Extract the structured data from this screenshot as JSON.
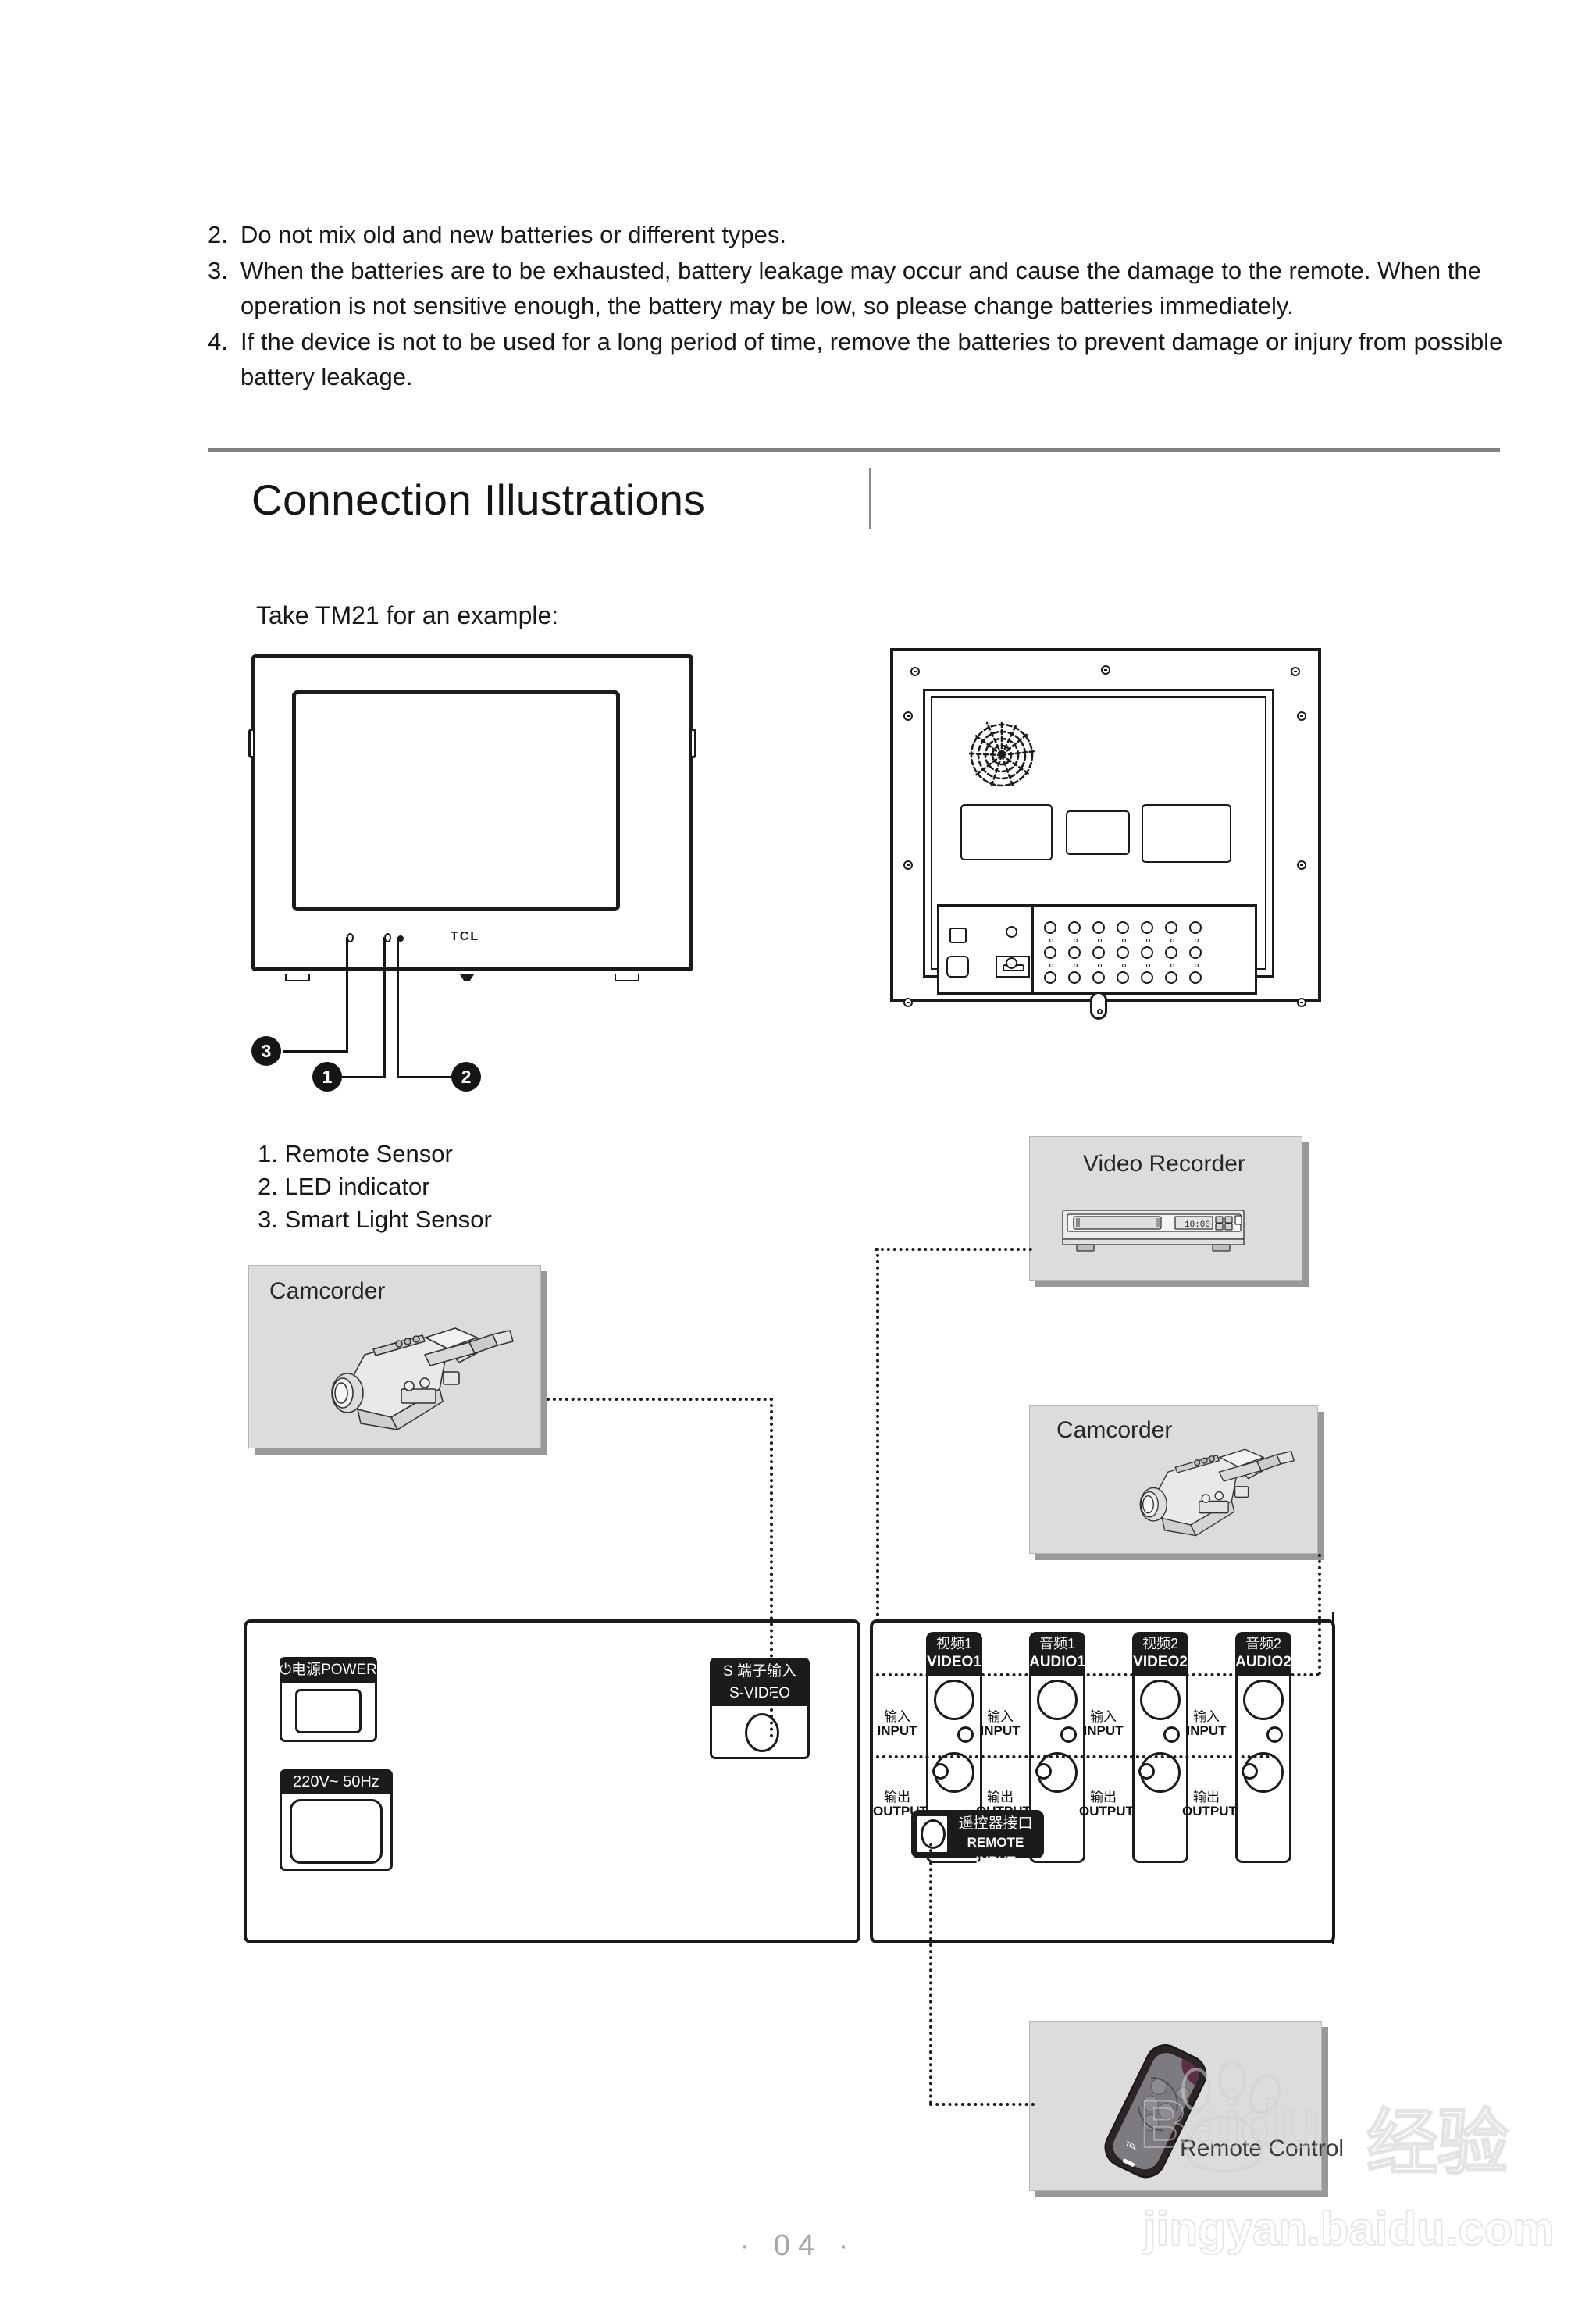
{
  "notes": [
    {
      "num": "2.",
      "text": "Do not mix old and new batteries or different types."
    },
    {
      "num": "3.",
      "text": "When the batteries are to be exhausted, battery leakage may occur and cause the damage to the remote. When the operation is not sensitive enough, the battery may be low, so please change batteries immediately."
    },
    {
      "num": "4.",
      "text": "If the device is not to be used for a long period of time, remove the batteries to prevent damage or injury from possible battery leakage."
    }
  ],
  "section": {
    "title": "Connection Illustrations",
    "example_line": "Take TM21 for an example:"
  },
  "front_view": {
    "brand": "TCL",
    "callouts": [
      "1",
      "2",
      "3"
    ]
  },
  "legend": [
    "1. Remote Sensor",
    "2. LED indicator",
    "3. Smart Light Sensor"
  ],
  "devices": [
    {
      "label": "Camcorder"
    },
    {
      "label": "Video Recorder"
    },
    {
      "label": "Camcorder"
    },
    {
      "label": "Remote Control"
    }
  ],
  "panel_left": {
    "power": {
      "cn": "电源",
      "en": "POWER",
      "symbol": "⏻"
    },
    "voltage": "220V~ 50Hz",
    "svideo": {
      "cn": "S 端子输入",
      "en": "S-VIDEO"
    }
  },
  "panel_right": {
    "strips": [
      {
        "cn": "视频1",
        "en": "VIDEO1"
      },
      {
        "cn": "音频1",
        "en": "AUDIO1"
      },
      {
        "cn": "视频2",
        "en": "VIDEO2"
      },
      {
        "cn": "音频2",
        "en": "AUDIO2"
      }
    ],
    "io": {
      "input_cn": "输入",
      "input_en": "INPUT",
      "output_cn": "输出",
      "output_en": "OUTPUT"
    },
    "remote": {
      "cn": "遥控器接口",
      "en": "REMOTE INPUT"
    }
  },
  "watermark": {
    "brand": "Baidu",
    "brand_cn": "经验",
    "url": "jingyan.baidu.com"
  },
  "footer": {
    "page": "· 04 ·"
  },
  "colors": {
    "ink": "#1b1b1b",
    "rule": "#808080",
    "device_fill": "#dcdcdc",
    "device_shadow": "#999999",
    "footer": "#a6a6a6"
  }
}
